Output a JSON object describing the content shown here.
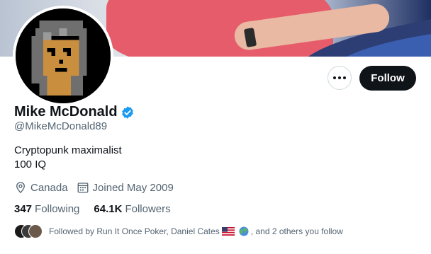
{
  "profile": {
    "name": "Mike McDonald",
    "handle": "@MikeMcDonald89",
    "bio_line1": "Cryptopunk maximalist",
    "bio_line2": "100 IQ",
    "location": "Canada",
    "joined": "Joined May 2009",
    "verified": true
  },
  "actions": {
    "follow_label": "Follow",
    "more_icon": "more-dots-icon"
  },
  "stats": {
    "following_count": "347",
    "following_label": "Following",
    "followers_count": "64.1K",
    "followers_label": "Followers"
  },
  "followed_by": {
    "prefix": "Followed by Run It Once Poker,",
    "name2": "Daniel Cates",
    "suffix": ", and 2 others you follow"
  },
  "colors": {
    "text_primary": "#0f1419",
    "text_secondary": "#536471",
    "verified_blue": "#1d9bf0",
    "follow_bg": "#0f1419"
  },
  "icons": [
    "location-pin-icon",
    "calendar-icon",
    "verified-badge-icon",
    "more-dots-icon",
    "flag-us-icon",
    "globe-icon"
  ]
}
